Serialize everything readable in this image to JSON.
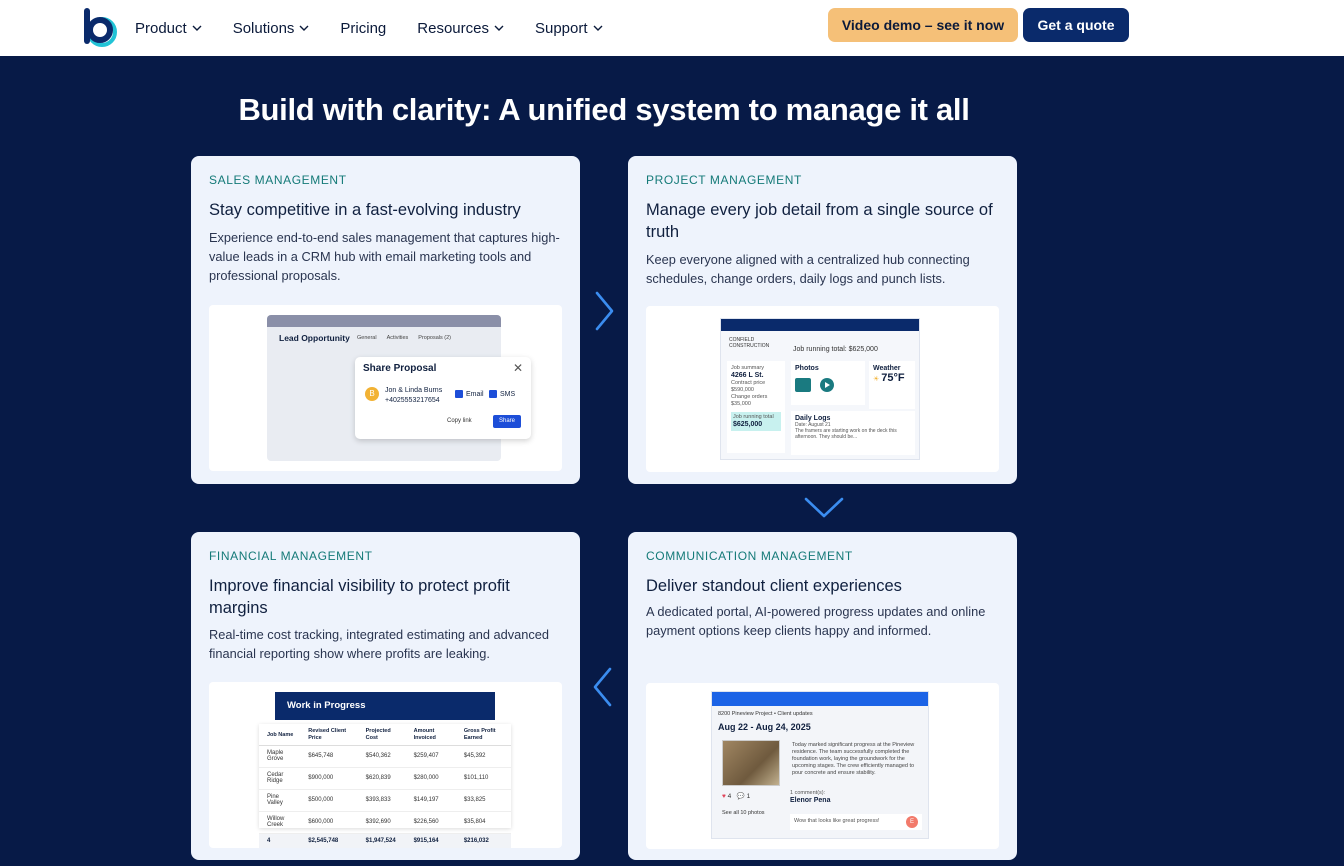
{
  "nav": {
    "items": [
      {
        "label": "Product",
        "has_dropdown": true
      },
      {
        "label": "Solutions",
        "has_dropdown": true
      },
      {
        "label": "Pricing",
        "has_dropdown": false
      },
      {
        "label": "Resources",
        "has_dropdown": true
      },
      {
        "label": "Support",
        "has_dropdown": true
      }
    ],
    "demo_button": "Video demo – see it now",
    "quote_button": "Get a quote"
  },
  "headline": "Build with clarity: A unified system to manage it all",
  "cards": {
    "sales": {
      "eyebrow": "SALES MANAGEMENT",
      "title": "Stay competitive in a fast-evolving industry",
      "description": "Experience end-to-end sales management that captures high-value leads in a CRM hub with email marketing tools and professional proposals.",
      "mock": {
        "window_title": "Lead Opportunity",
        "tabs": [
          "General",
          "Activities",
          "Proposals (2)"
        ],
        "dialog_title": "Share Proposal",
        "close": "✕",
        "avatar_initial": "B",
        "client_name": "Jon & Linda Burns",
        "client_phone": "+4025553217654",
        "email_label": "Email",
        "sms_label": "SMS",
        "copy_link": "Copy link",
        "share": "Share"
      }
    },
    "project": {
      "eyebrow": "PROJECT MANAGEMENT",
      "title": "Manage every job detail from a single source of truth",
      "description": "Keep everyone aligned with a centralized hub connecting schedules, change orders, daily logs and punch lists.",
      "mock": {
        "company": "CONFIELD CONSTRUCTION",
        "running_total": "Job running total: $625,000",
        "summary_label": "Job summary",
        "address": "4266 L St.",
        "contract_price_label": "Contract price",
        "contract_price": "$590,000",
        "change_orders_label": "Change orders",
        "change_orders": "$35,000",
        "job_total_label": "Job running total",
        "job_total": "$625,000",
        "photos_label": "Photos",
        "weather_label": "Weather",
        "temperature": "75°F",
        "daily_logs_label": "Daily Logs",
        "log_date": "Date: August 21",
        "log_text": "The framers are starting work on the deck this afternoon. They should be..."
      }
    },
    "financial": {
      "eyebrow": "FINANCIAL MANAGEMENT",
      "title": "Improve financial visibility to protect profit margins",
      "description": "Real-time cost tracking, integrated estimating and advanced financial reporting show where profits are leaking.",
      "mock": {
        "window_title": "Work in Progress",
        "headers": [
          "Job Name",
          "Revised Client Price",
          "Projected Cost",
          "Amount Invoiced",
          "Gross Profit Earned"
        ],
        "rows": [
          [
            "Maple Grove",
            "$645,748",
            "$540,362",
            "$259,407",
            "$45,392"
          ],
          [
            "Cedar Ridge",
            "$900,000",
            "$620,839",
            "$280,000",
            "$101,110"
          ],
          [
            "Pine Valley",
            "$500,000",
            "$393,833",
            "$149,197",
            "$33,825"
          ],
          [
            "Willow Creek",
            "$600,000",
            "$392,690",
            "$226,560",
            "$35,804"
          ]
        ],
        "totals": [
          "4",
          "$2,545,748",
          "$1,947,524",
          "$915,164",
          "$216,032"
        ]
      }
    },
    "communication": {
      "eyebrow": "COMMUNICATION MANAGEMENT",
      "title": "Deliver standout client experiences",
      "description": "A dedicated portal, AI-powered progress updates and online payment options keep clients happy and informed.",
      "mock": {
        "project_title": "8200 Pineview Project • Client updates",
        "date_range": "Aug 22 - Aug 24, 2025",
        "update_text": "Today marked significant progress at the Pineview residence. The team successfully completed the foundation work, laying the groundwork for the upcoming stages. The crew efficiently managed to pour concrete and ensure stability.",
        "likes": "4",
        "comments": "1",
        "see_all": "See all 10 photos",
        "comment_count": "1 comment(s):",
        "commenter": "Elenor Pena",
        "comment": "Wow that looks like great progress!",
        "commenter_initial": "E"
      }
    }
  },
  "colors": {
    "background": "#071a47",
    "card": "#eef3fc",
    "eyebrow": "#147a78",
    "demo_button": "#f5c078",
    "quote_button": "#0a2a6b",
    "arrow": "#3b8df0"
  }
}
